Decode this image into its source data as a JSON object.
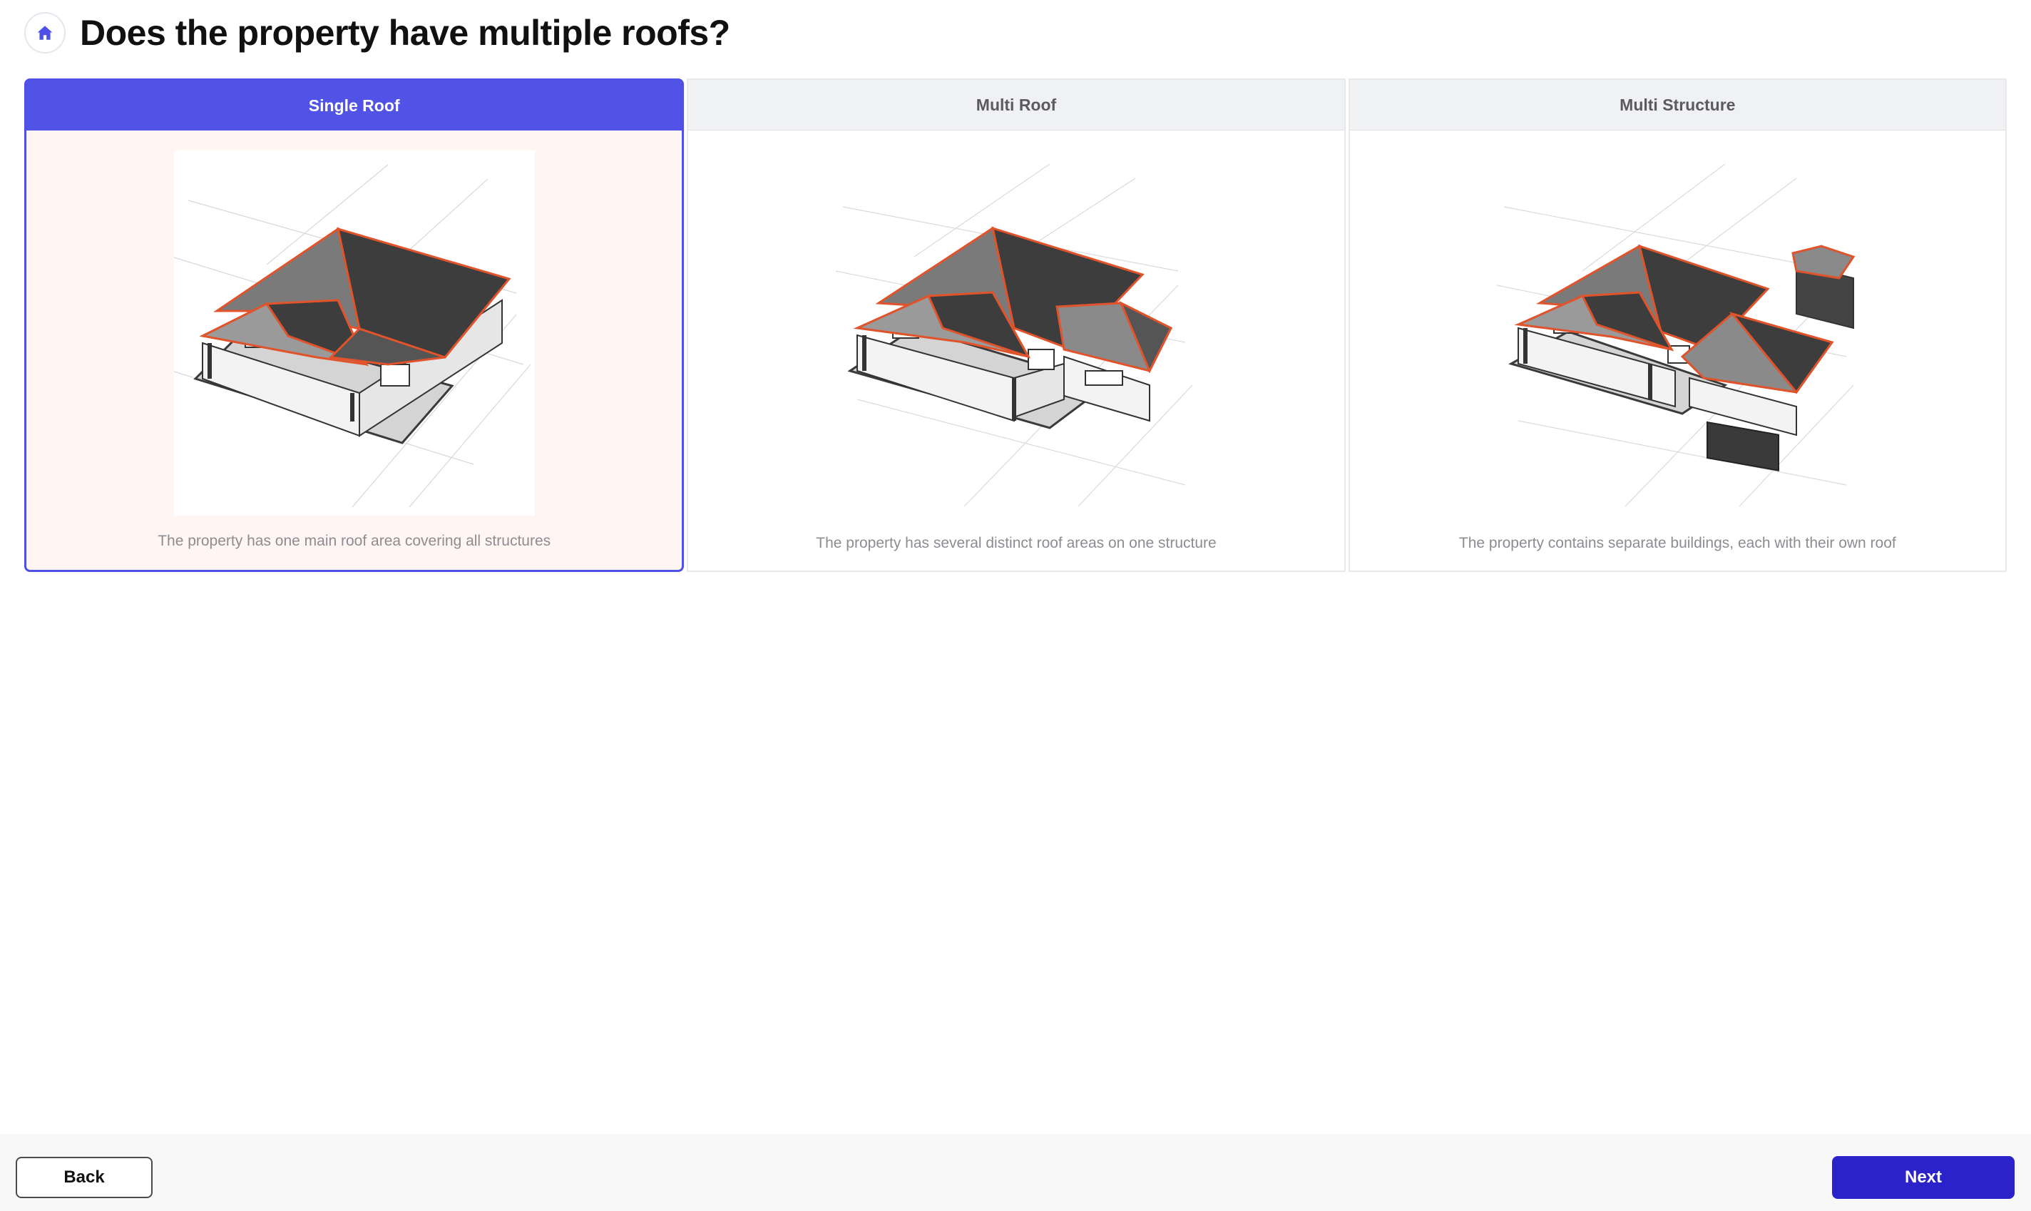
{
  "header": {
    "home_icon": "home-icon",
    "title": "Does the property have multiple roofs?"
  },
  "options": [
    {
      "label": "Single Roof",
      "description": "The property has one main roof area covering all structures",
      "selected": true,
      "illustration": "single-roof-house"
    },
    {
      "label": "Multi Roof",
      "description": "The property has several distinct roof areas on one structure",
      "selected": false,
      "illustration": "multi-roof-house"
    },
    {
      "label": "Multi Structure",
      "description": "The property contains separate buildings, each with their own roof",
      "selected": false,
      "illustration": "multi-structure-house"
    }
  ],
  "footer": {
    "back_label": "Back",
    "next_label": "Next"
  },
  "colors": {
    "accent": "#5152e6",
    "next_button": "#2b22c9",
    "selected_background": "#fff5f2",
    "roof_outline": "#e0532b"
  }
}
